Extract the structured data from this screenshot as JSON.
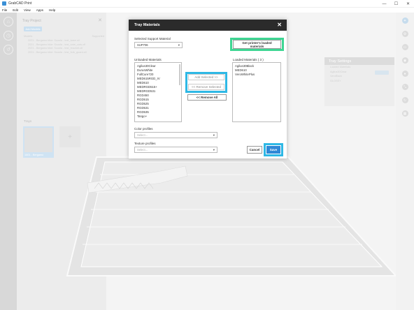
{
  "window": {
    "title": "GrabCAD Print",
    "minimize": "—",
    "maximize": "☐",
    "close": "✕"
  },
  "menu": [
    "File",
    "Edit",
    "View",
    "Apps",
    "Help"
  ],
  "left_panel": {
    "title": "Tray Project",
    "close": "✕",
    "add_model": "Add Models",
    "models_header_left": "Models",
    "models_header_right": "Supported",
    "models": [
      "2021 - Bergamo bike: Scuola - test_base.ctl",
      "2021 - Bergamo bike: Scuola - test_tube_cuts.ctl",
      "2021 - Bergamo bike: Scuola - test_bracket.ctl",
      "2021 - Bergamo bike: Scuola - test_fork_guard.ctl"
    ],
    "trays_label": "Trays",
    "tray_caption": "1001 - Bergamo",
    "tray_add": "+"
  },
  "tray_settings": {
    "title": "Tray Settings",
    "rows": [
      "Loaded Materials",
      "Agilus30Clear",
      "VeroBlack",
      "GLOSSY"
    ]
  },
  "dialog": {
    "title": "Tray Materials",
    "close": "✕",
    "support_label": "Selected Support Material",
    "support_value": "SUP706",
    "support_caret": "▾",
    "get_loaded": "Get printer's loaded materials",
    "unloaded_label": "Unloaded Materials",
    "unloaded": [
      "Agilus30Clear",
      "DurusWhite",
      "FullCure720",
      "MED615RGD_IV",
      "MED610",
      "MEDRGD515+",
      "MEDRGD531",
      "RGD450",
      "RGD515",
      "RGD525",
      "RGD531",
      "RGD535",
      "Tango+"
    ],
    "loaded_label": "Loaded Materials ( 3 )",
    "loaded": [
      "Agilus30Black",
      "MED610",
      "VeroWhitePlus"
    ],
    "add_selected": "Add Selected >>",
    "remove_selected": "<< Remove Selected",
    "remove_all": "<< Remove All",
    "color_label": "Color profiles",
    "color_placeholder": "Select...",
    "texture_label": "Texture profiles",
    "texture_placeholder": "Select...",
    "cancel": "Cancel",
    "save": "Save"
  },
  "colors": {
    "highlight_blue": "#2eb8e5",
    "highlight_green": "#3ed693",
    "save_blue": "#2f88d6",
    "dialog_header": "#2b2b2b"
  }
}
